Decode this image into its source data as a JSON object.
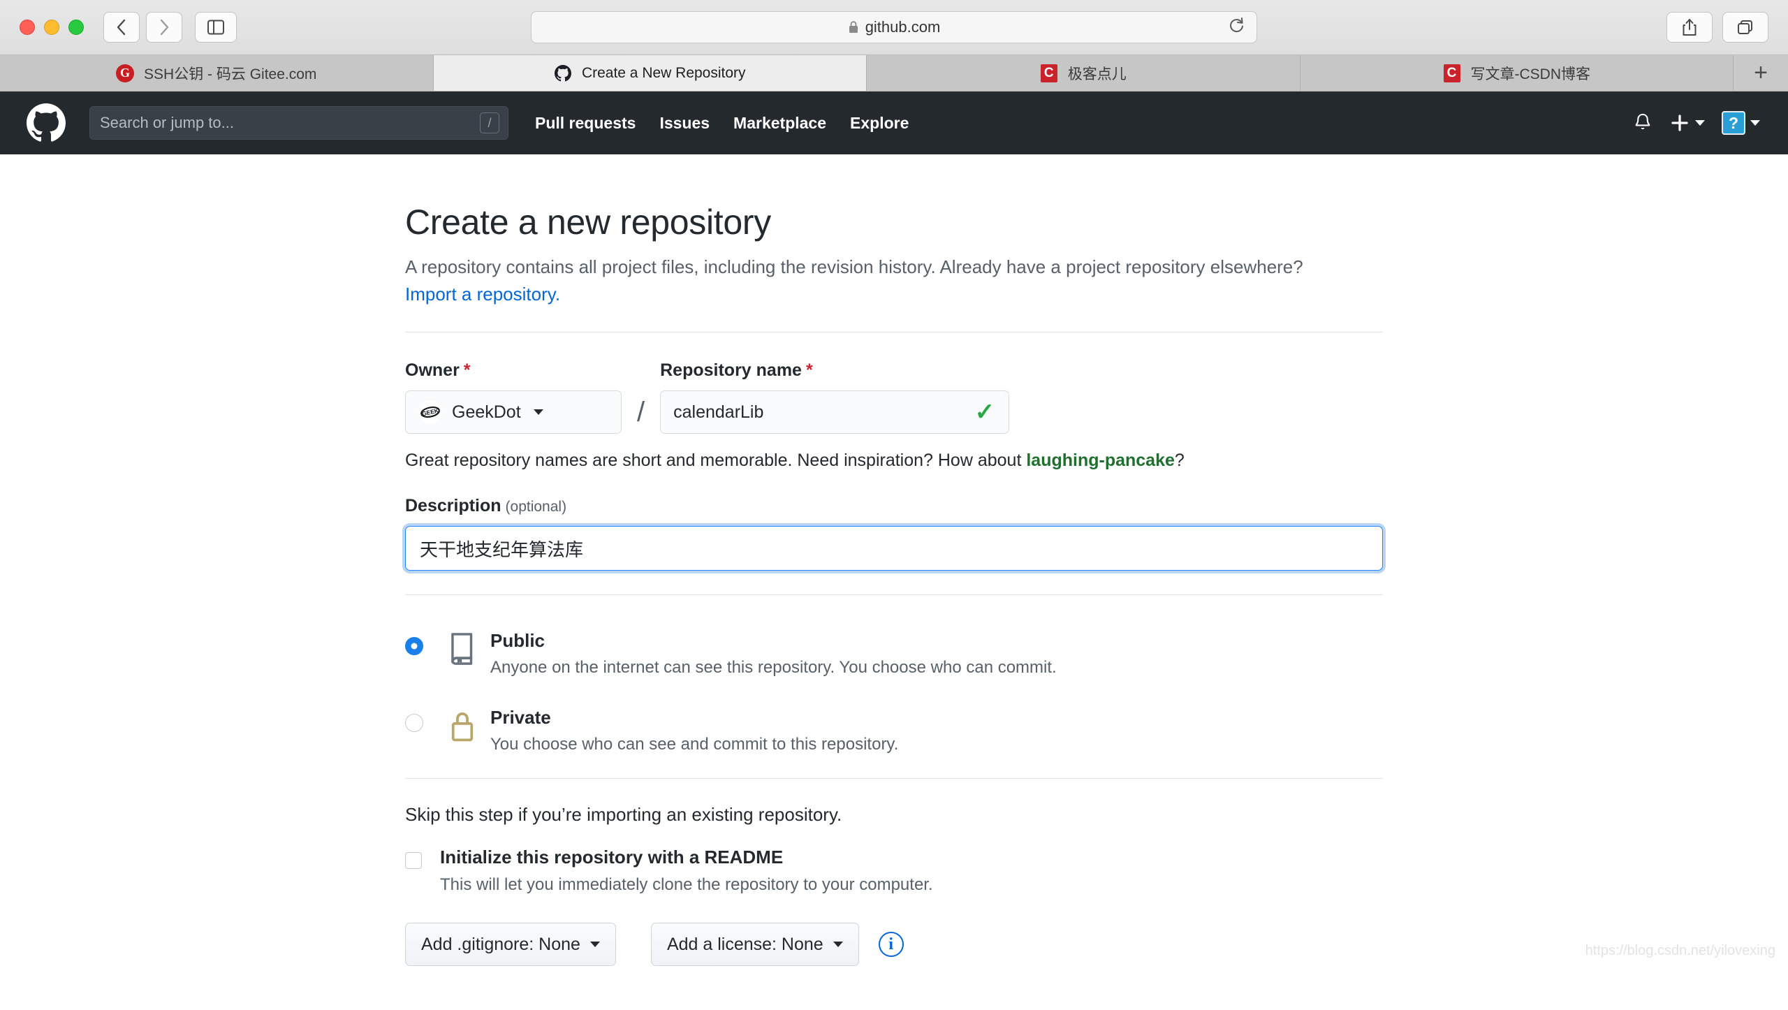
{
  "browser": {
    "url": "github.com",
    "lock_icon": "lock-icon",
    "reload_icon": "reload-icon",
    "back_icon": "back-chevron-icon",
    "forward_icon": "forward-chevron-icon",
    "sidebar_icon": "sidebar-toggle-icon",
    "share_icon": "share-icon",
    "tab_overview_icon": "tab-overview-icon",
    "new_tab_label": "+",
    "tabs": [
      {
        "label": "SSH公钥 - 码云 Gitee.com",
        "favicon": "G",
        "favicon_kind": "gitee",
        "active": false
      },
      {
        "label": "Create a New Repository",
        "favicon": "github",
        "favicon_kind": "github",
        "active": true
      },
      {
        "label": "极客点儿",
        "favicon": "C",
        "favicon_kind": "csdn",
        "active": false
      },
      {
        "label": "写文章-CSDN博客",
        "favicon": "C",
        "favicon_kind": "csdn",
        "active": false
      }
    ]
  },
  "gh_header": {
    "logo_icon": "github-mark-icon",
    "search_placeholder": "Search or jump to...",
    "search_value": "",
    "search_shortcut": "/",
    "nav": [
      {
        "label": "Pull requests"
      },
      {
        "label": "Issues"
      },
      {
        "label": "Marketplace"
      },
      {
        "label": "Explore"
      }
    ],
    "bell_icon": "notification-bell-icon",
    "plus_icon": "plus-icon",
    "avatar_text": "?",
    "avatar_color": "#2a9fd6"
  },
  "main": {
    "title": "Create a new repository",
    "lead_part1": "A repository contains all project files, including the revision history. Already have a project repository elsewhere? ",
    "lead_link": "Import a repository.",
    "owner": {
      "label": "Owner",
      "required_mark": "*",
      "value": "GeekDot",
      "avatar_text": "GEEK"
    },
    "separator": "/",
    "repo": {
      "label": "Repository name",
      "required_mark": "*",
      "value": "calendarLib",
      "placeholder": "",
      "valid_icon": "✓",
      "valid_color": "#28a745"
    },
    "name_hint_part1": "Great repository names are short and memorable. Need inspiration? How about ",
    "name_hint_suggestion": "laughing-pancake",
    "name_hint_part2": "?",
    "description": {
      "label": "Description",
      "optional_label": "(optional)",
      "value": "天干地支纪年算法库",
      "placeholder": ""
    },
    "visibility": [
      {
        "id": "public",
        "title": "Public",
        "desc": "Anyone on the internet can see this repository. You choose who can commit.",
        "selected": true,
        "icon": "repo-book-icon",
        "icon_color": "#6a737d"
      },
      {
        "id": "private",
        "title": "Private",
        "desc": "You choose who can see and commit to this repository.",
        "selected": false,
        "icon": "lock-icon",
        "icon_color": "#b9a66b"
      }
    ],
    "skip_text": "Skip this step if you’re importing an existing repository.",
    "readme": {
      "title": "Initialize this repository with a README",
      "desc": "This will let you immediately clone the repository to your computer.",
      "checked": false
    },
    "gitignore_button": "Add .gitignore: None",
    "license_button": "Add a license: None",
    "info_icon": "info-icon"
  },
  "watermark": "https://blog.csdn.net/yilovexing"
}
